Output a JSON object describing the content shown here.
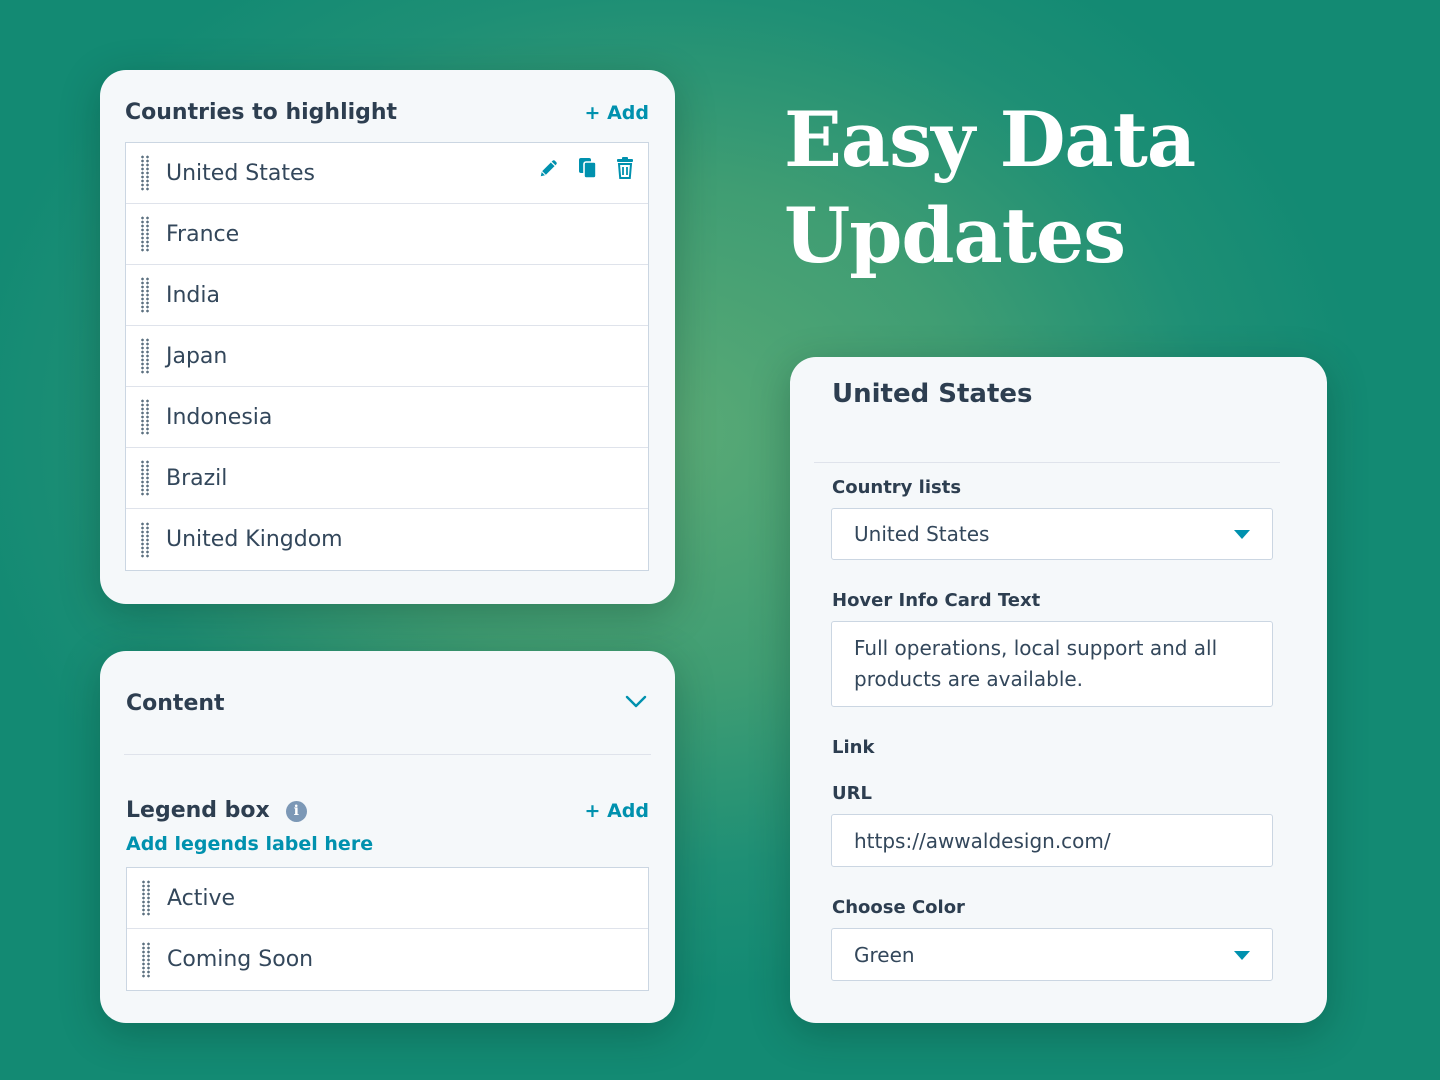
{
  "headline": {
    "line1": "Easy Data",
    "line2": "Updates"
  },
  "countries": {
    "title": "Countries to highlight",
    "add_label": "+ Add",
    "items": [
      {
        "label": "United States"
      },
      {
        "label": "France"
      },
      {
        "label": "India"
      },
      {
        "label": "Japan"
      },
      {
        "label": "Indonesia"
      },
      {
        "label": "Brazil"
      },
      {
        "label": "United Kingdom"
      }
    ],
    "row_action_icons": [
      "pencil-icon",
      "copy-icon",
      "trash-icon"
    ]
  },
  "content": {
    "title": "Content",
    "legend": {
      "title": "Legend box",
      "add_label": "+ Add",
      "sub_link": "Add legends label here",
      "items": [
        {
          "label": "Active"
        },
        {
          "label": "Coming Soon"
        }
      ]
    }
  },
  "detail": {
    "title": "United States",
    "country_lists": {
      "label": "Country lists",
      "value": "United States"
    },
    "hover_text": {
      "label": "Hover Info Card Text",
      "value": "Full operations, local support and all products are available."
    },
    "link": {
      "label": "Link"
    },
    "url": {
      "label": "URL",
      "value": "https://awwaldesign.com/"
    },
    "color": {
      "label": "Choose Color",
      "value": "Green"
    }
  },
  "colors": {
    "accent": "#0091ae",
    "text": "#33475b",
    "card_bg": "#f5f8fa",
    "border": "#cbd6e2"
  }
}
